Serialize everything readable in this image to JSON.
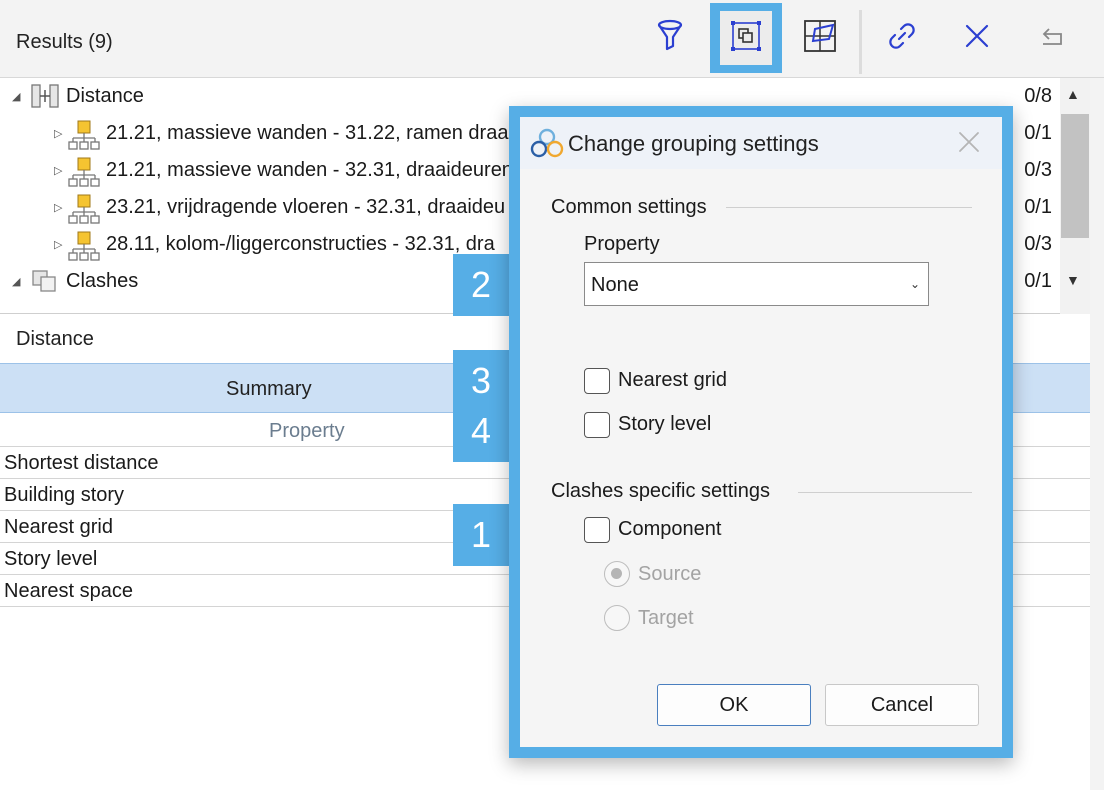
{
  "toolbar": {
    "results_title": "Results (9)",
    "buttons": [
      {
        "icon": "filter-icon"
      },
      {
        "icon": "grouping-settings-icon",
        "active": true
      },
      {
        "icon": "section-box-icon"
      },
      {
        "icon": "link-icon"
      },
      {
        "icon": "close-icon"
      },
      {
        "icon": "undo-icon"
      }
    ]
  },
  "tree": {
    "nodes": [
      {
        "label": "Distance",
        "count": "0/8",
        "expanded": true,
        "level": 0
      },
      {
        "label": "21.21, massieve wanden - 31.22, ramen draa",
        "count": "0/1",
        "level": 1
      },
      {
        "label": "21.21, massieve wanden - 32.31, draaideuren",
        "count": "0/3",
        "level": 1
      },
      {
        "label": "23.21, vrijdragende vloeren - 32.31, draaideu",
        "count": "0/1",
        "level": 1
      },
      {
        "label": "28.11, kolom-/liggerconstructies - 32.31, dra",
        "count": "0/3",
        "level": 1
      },
      {
        "label": "Clashes",
        "count": "0/1",
        "expanded": true,
        "level": 0
      }
    ]
  },
  "properties": {
    "section_title": "Distance",
    "summary_label": "Summary",
    "column_header": "Property",
    "rows": [
      "Shortest distance",
      "Building story",
      "Nearest grid",
      "Story level",
      "Nearest space"
    ]
  },
  "callouts": [
    "2",
    "3",
    "4",
    "1"
  ],
  "dialog": {
    "title": "Change grouping settings",
    "common_settings_label": "Common settings",
    "property_label": "Property",
    "property_value": "None",
    "nearest_grid_label": "Nearest grid",
    "story_level_label": "Story level",
    "clashes_settings_label": "Clashes specific settings",
    "component_label": "Component",
    "source_label": "Source",
    "target_label": "Target",
    "ok_label": "OK",
    "cancel_label": "Cancel"
  },
  "colors": {
    "accent": "#56aee6",
    "summary_bg": "#cce0f5",
    "icon_blue": "#2b3fd1",
    "tree_node_yellow": "#f5c431"
  }
}
